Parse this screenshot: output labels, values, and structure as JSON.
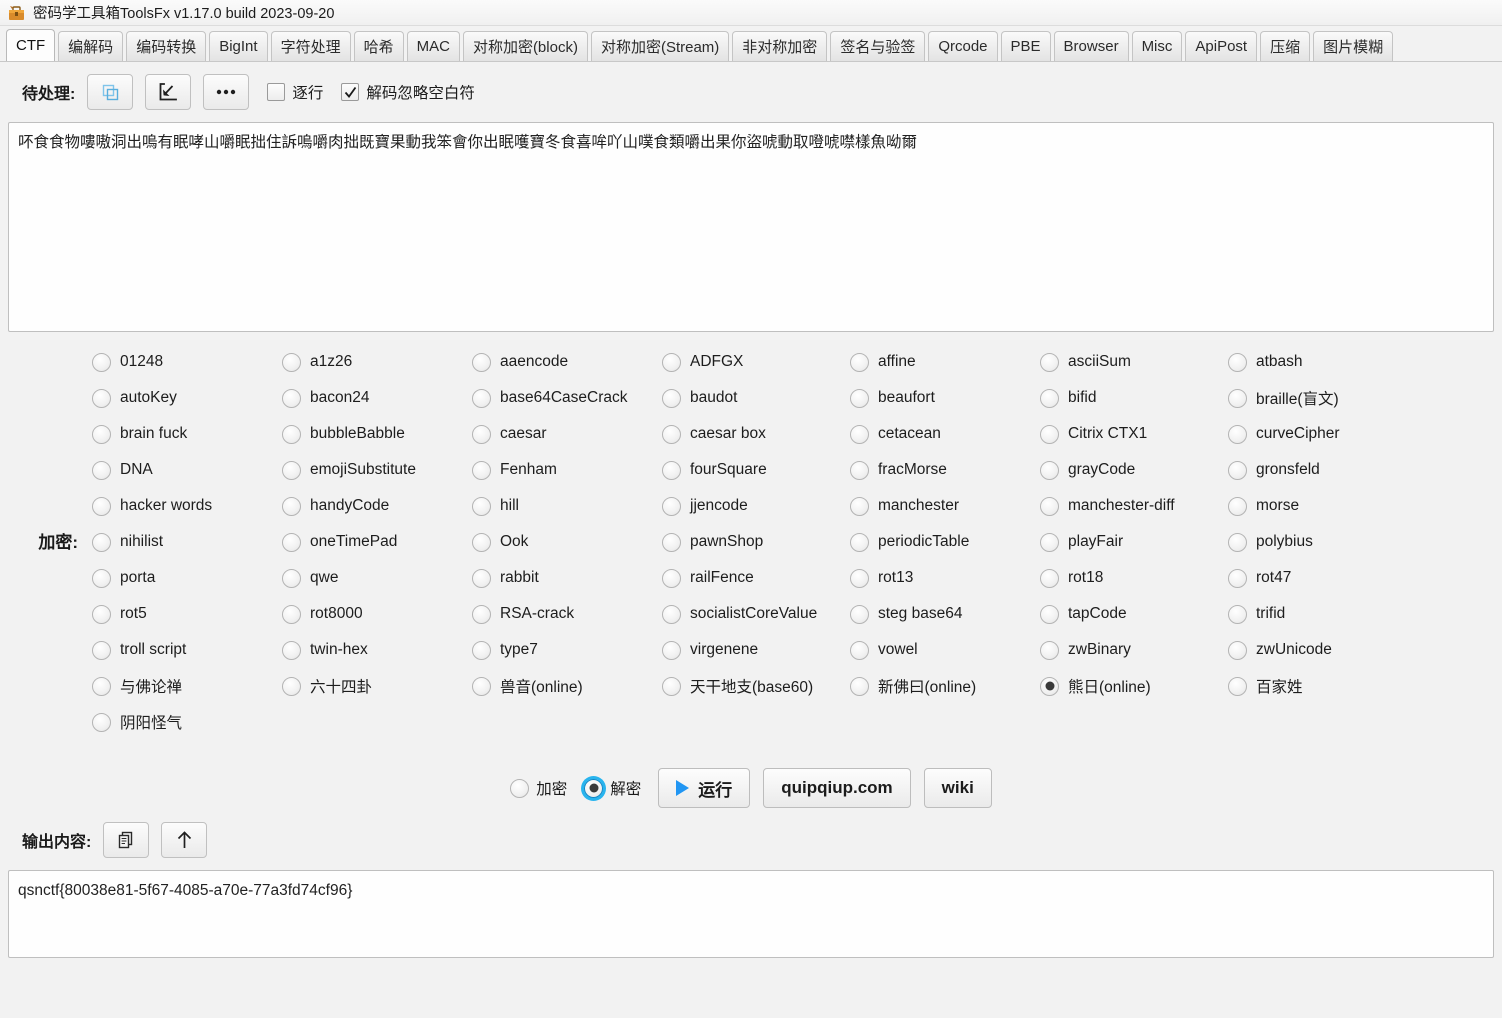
{
  "window": {
    "title": "密码学工具箱ToolsFx v1.17.0 build 2023-09-20",
    "icon": "toolbox-icon"
  },
  "tabs": [
    {
      "label": "CTF",
      "selected": true
    },
    {
      "label": "编解码",
      "selected": false
    },
    {
      "label": "编码转换",
      "selected": false
    },
    {
      "label": "BigInt",
      "selected": false
    },
    {
      "label": "字符处理",
      "selected": false
    },
    {
      "label": "哈希",
      "selected": false
    },
    {
      "label": "MAC",
      "selected": false
    },
    {
      "label": "对称加密(block)",
      "selected": false
    },
    {
      "label": "对称加密(Stream)",
      "selected": false
    },
    {
      "label": "非对称加密",
      "selected": false
    },
    {
      "label": "签名与验签",
      "selected": false
    },
    {
      "label": "Qrcode",
      "selected": false
    },
    {
      "label": "PBE",
      "selected": false
    },
    {
      "label": "Browser",
      "selected": false
    },
    {
      "label": "Misc",
      "selected": false
    },
    {
      "label": "ApiPost",
      "selected": false
    },
    {
      "label": "压缩",
      "selected": false
    },
    {
      "label": "图片模糊",
      "selected": false
    }
  ],
  "input_section": {
    "label": "待处理:",
    "buttons": [
      {
        "name": "copy-button",
        "icon": "copy-icon"
      },
      {
        "name": "paste-button",
        "icon": "import-arrow-icon"
      },
      {
        "name": "more-button",
        "icon": "ellipsis-icon"
      }
    ],
    "checkboxes": [
      {
        "label": "逐行",
        "checked": false,
        "name": "line-by-line-checkbox"
      },
      {
        "label": "解码忽略空白符",
        "checked": true,
        "name": "ignore-whitespace-checkbox"
      }
    ],
    "value": "吥食食物嘍嗷洞出嗚有眠哮山嚼眠拙住訴嗚嚼肉拙既寶果動我笨會你出眠嚄寶冬食喜哞吖山噗食類嚼出果你盜唬動取噔唬噤樣魚呦爾",
    "placeholder": ""
  },
  "cipher_section": {
    "label": "加密:",
    "selected": "熊日(online)",
    "options": [
      "01248",
      "a1z26",
      "aaencode",
      "ADFGX",
      "affine",
      "asciiSum",
      "atbash",
      "autoKey",
      "bacon24",
      "base64CaseCrack",
      "baudot",
      "beaufort",
      "bifid",
      "braille(盲文)",
      "brain fuck",
      "bubbleBabble",
      "caesar",
      "caesar box",
      "cetacean",
      "Citrix CTX1",
      "curveCipher",
      "DNA",
      "emojiSubstitute",
      "Fenham",
      "fourSquare",
      "fracMorse",
      "grayCode",
      "gronsfeld",
      "hacker words",
      "handyCode",
      "hill",
      "jjencode",
      "manchester",
      "manchester-diff",
      "morse",
      "nihilist",
      "oneTimePad",
      "Ook",
      "pawnShop",
      "periodicTable",
      "playFair",
      "polybius",
      "porta",
      "qwe",
      "rabbit",
      "railFence",
      "rot13",
      "rot18",
      "rot47",
      "rot5",
      "rot8000",
      "RSA-crack",
      "socialistCoreValue",
      "steg base64",
      "tapCode",
      "trifid",
      "troll script",
      "twin-hex",
      "type7",
      "virgenene",
      "vowel",
      "zwBinary",
      "zwUnicode",
      "与佛论禅",
      "六十四卦",
      "兽音(online)",
      "天干地支(base60)",
      "新佛曰(online)",
      "熊日(online)",
      "百家姓",
      "阴阳怪气"
    ]
  },
  "action_row": {
    "modes": [
      {
        "label": "加密",
        "selected": false,
        "name": "mode-encrypt-radio"
      },
      {
        "label": "解密",
        "selected": true,
        "name": "mode-decrypt-radio"
      }
    ],
    "run_button": {
      "label": "运行",
      "icon": "play-icon"
    },
    "links": [
      {
        "label": "quipqiup.com",
        "name": "quipqiup-button"
      },
      {
        "label": "wiki",
        "name": "wiki-button"
      }
    ]
  },
  "output_section": {
    "label": "输出内容:",
    "buttons": [
      {
        "name": "copy-output-button",
        "icon": "copy-doc-icon"
      },
      {
        "name": "send-up-button",
        "icon": "arrow-up-icon"
      }
    ],
    "value": "qsnctf{80038e81-5f67-4085-a70e-77a3fd74cf96}"
  },
  "colors": {
    "accent": "#2196f3",
    "focus_ring": "#28b4ee",
    "window_bg": "#f2f2f2",
    "field_bg": "#fefefe"
  }
}
